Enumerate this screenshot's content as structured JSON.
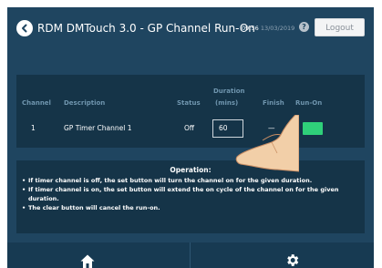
{
  "header": {
    "title": "RDM DMTouch 3.0 - GP Channel Run-On",
    "time": "09:56",
    "date": "13/03/2019",
    "help_label": "?",
    "logout_label": "Logout"
  },
  "table": {
    "columns": {
      "channel": "Channel",
      "description": "Description",
      "status": "Status",
      "duration_line1": "Duration",
      "duration_line2": "(mins)",
      "finish": "Finish",
      "runon": "Run-On"
    },
    "rows": [
      {
        "channel": "1",
        "description": "GP Timer Channel 1",
        "status": "Off",
        "duration": "60",
        "finish": "—"
      }
    ]
  },
  "operation": {
    "title": "Operation:",
    "items": [
      "If timer channel is off, the set button will turn the channel on for the given duration.",
      "If timer channel is on, the set button will extend the on cycle of the channel on for the given duration.",
      "The clear button will cancel the run-on."
    ]
  },
  "colors": {
    "screen_bg": "#1f4560",
    "panel_bg": "#153448",
    "header_text": "#6f95ae",
    "runon_button": "#2fd07a"
  },
  "icons": {
    "back": "back-arrow-icon",
    "help": "help-icon",
    "home": "home-icon",
    "settings": "gear-icon",
    "pointer": "hand-pointer-icon"
  }
}
